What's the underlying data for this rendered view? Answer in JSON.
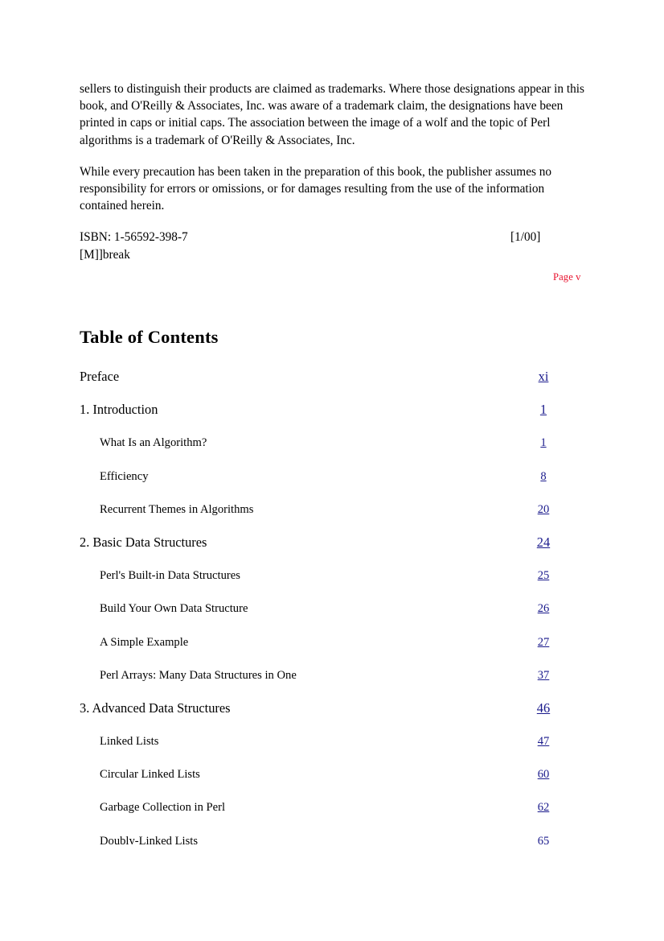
{
  "front_matter": {
    "paragraphs": [
      "sellers to distinguish their products are claimed as trademarks. Where those designations appear in this book, and O'Reilly & Associates, Inc. was aware of a trademark claim, the designations have been printed in caps or initial caps. The association between the image of a wolf and the topic of Perl algorithms is a trademark of O'Reilly & Associates, Inc.",
      "While every precaution has been taken in the preparation of this book, the publisher assumes no responsibility for errors or omissions, or for damages resulting from the use of the information contained herein."
    ],
    "isbn": "ISBN: 1-56592-398-7",
    "print_date": "[1/00]",
    "break_marker": "[M]]break"
  },
  "page_marker": {
    "label": "Page v",
    "color": "#e8112d"
  },
  "toc": {
    "title": "Table of Contents",
    "link_color": "#1a1a8c",
    "entries": [
      {
        "label": "Preface",
        "page": "xi",
        "level": "chapter"
      },
      {
        "label": "1. Introduction",
        "page": "1",
        "level": "chapter"
      },
      {
        "label": "What Is an Algorithm?",
        "page": "1",
        "level": "section"
      },
      {
        "label": "Efficiency",
        "page": "8",
        "level": "section"
      },
      {
        "label": "Recurrent Themes in Algorithms",
        "page": "20",
        "level": "section"
      },
      {
        "label": "2. Basic Data Structures",
        "page": "24",
        "level": "chapter"
      },
      {
        "label": "Perl's Built-in Data Structures",
        "page": "25",
        "level": "section"
      },
      {
        "label": "Build Your Own Data Structure",
        "page": "26",
        "level": "section"
      },
      {
        "label": "A Simple Example",
        "page": "27",
        "level": "section"
      },
      {
        "label": "Perl Arrays: Many Data Structures in One",
        "page": "37",
        "level": "section"
      },
      {
        "label": "3. Advanced Data Structures",
        "page": "46",
        "level": "chapter"
      },
      {
        "label": "Linked Lists",
        "page": "47",
        "level": "section"
      },
      {
        "label": "Circular Linked Lists",
        "page": "60",
        "level": "section"
      },
      {
        "label": "Garbage Collection in Perl",
        "page": "62",
        "level": "section"
      },
      {
        "label": "Doubly-Linked Lists",
        "page": "65",
        "level": "section"
      }
    ]
  }
}
